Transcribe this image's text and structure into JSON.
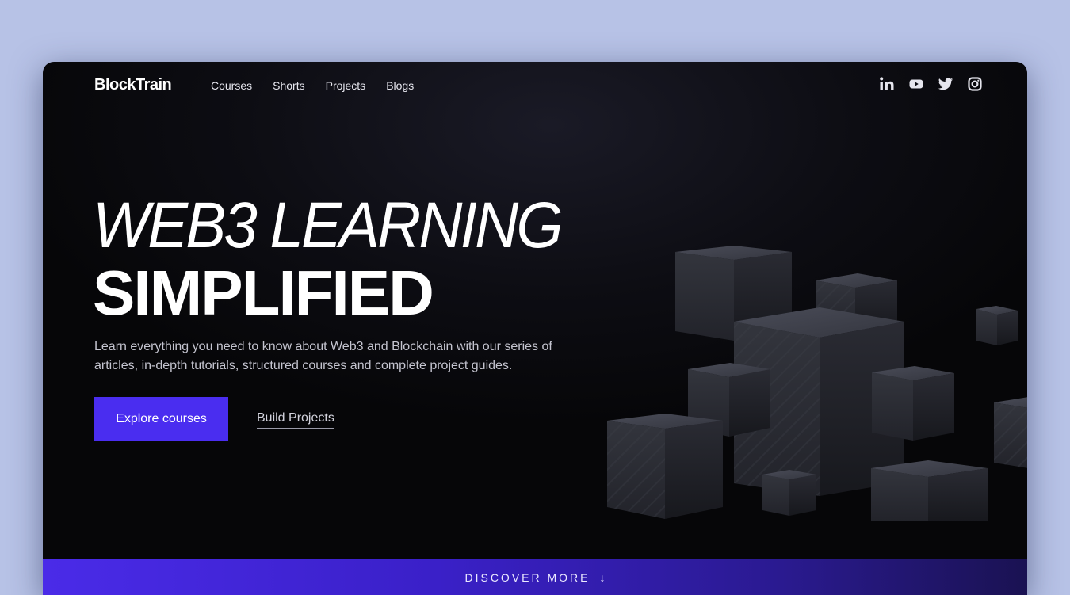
{
  "brand": "BlockTrain",
  "nav": {
    "links": [
      "Courses",
      "Shorts",
      "Projects",
      "Blogs"
    ]
  },
  "social": {
    "icons": [
      "linkedin-icon",
      "youtube-icon",
      "twitter-icon",
      "instagram-icon"
    ]
  },
  "hero": {
    "line1": "WEB3 LEARNING",
    "line2": "SIMPLIFIED",
    "description": "Learn everything you need to know about Web3 and Blockchain with our series of articles, in-depth tutorials, structured courses and complete project guides.",
    "primary_button": "Explore courses",
    "secondary_link": "Build Projects"
  },
  "discover": {
    "label": "DISCOVER MORE",
    "arrow": "↓"
  },
  "colors": {
    "accent": "#4a2df0",
    "page_background": "#b7c2e6",
    "hero_background": "#0a0a0e"
  }
}
